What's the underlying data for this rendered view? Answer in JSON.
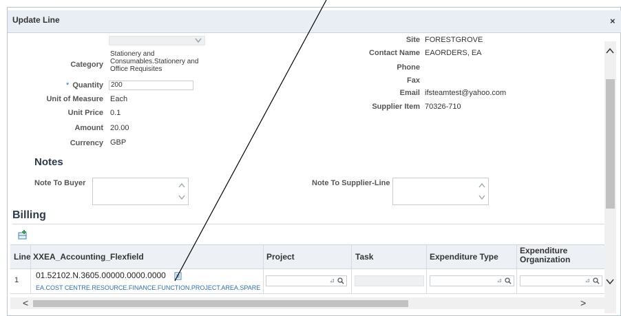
{
  "dialog": {
    "title": "Update Line",
    "close": "×"
  },
  "left_fields": {
    "category_label": "Category",
    "category_value": [
      "Stationery and",
      "Consumables.Stationery and",
      "Office Requisites"
    ],
    "quantity_star": "*",
    "quantity_label": "Quantity",
    "quantity_value": "200",
    "uom_label": "Unit of Measure",
    "uom_value": "Each",
    "unit_price_label": "Unit Price",
    "unit_price_value": "0.1",
    "amount_label": "Amount",
    "amount_value": "20.00",
    "currency_label": "Currency",
    "currency_value": "GBP"
  },
  "right_fields": {
    "site_label": "Site",
    "site_value": "FORESTGROVE",
    "contact_label": "Contact Name",
    "contact_value": "EAORDERS, EA",
    "phone_label": "Phone",
    "fax_label": "Fax",
    "email_label": "Email",
    "email_value": "ifsteamtest@yahoo.com",
    "supplier_item_label": "Supplier Item",
    "supplier_item_value": "70326-710"
  },
  "notes": {
    "heading": "Notes",
    "buyer_label": "Note To Buyer",
    "supplier_label": "Note To Supplier-Line"
  },
  "billing": {
    "heading": "Billing",
    "columns": [
      "Line",
      "XXEA_Accounting_Flexfield",
      "Project",
      "Task",
      "Expenditure Type",
      "Expenditure Organization"
    ],
    "expenditure_org_lines": [
      "Expenditure",
      "Organization"
    ],
    "row": {
      "line": "1",
      "flexfield": "01.52102.N.3605.00000.0000.0000",
      "flexfield_desc": "EA.COST CENTRE.RESOURCE.FINANCE.FUNCTION.PROJECT.AREA.SPARE"
    }
  },
  "icons": {
    "search": "🔍",
    "chevron_down": "⌄",
    "caret_up": "^",
    "nav_left": "<",
    "nav_right": ">"
  }
}
